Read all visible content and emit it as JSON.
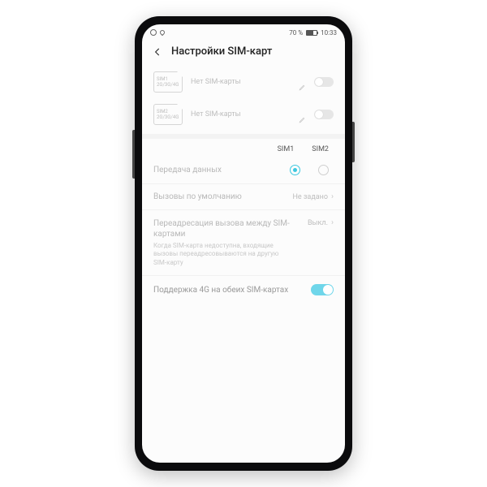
{
  "statusbar": {
    "battery_pct": "70 %",
    "time": "10:33"
  },
  "header": {
    "title": "Настройки SIM-карт"
  },
  "sim_slots": [
    {
      "name": "SIM1",
      "net": "2G/3G/4G",
      "status": "Нет SIM-карты"
    },
    {
      "name": "SIM2",
      "net": "2G/3G/4G",
      "status": "Нет SIM-карты"
    }
  ],
  "columns": {
    "sim1": "SIM1",
    "sim2": "SIM2"
  },
  "rows": {
    "data_transfer": {
      "label": "Передача данных",
      "selected": "sim1"
    },
    "default_calls": {
      "label": "Вызовы по умолчанию",
      "value": "Не задано"
    },
    "call_forward": {
      "title": "Переадресация вызова между SIM-картами",
      "desc": "Когда SIM-карта недоступна, входящие вызовы переадресовываются на другую SIM-карту",
      "value": "Выкл."
    },
    "dual4g": {
      "label": "Поддержка 4G на обеих SIM-картах",
      "on": true
    }
  }
}
